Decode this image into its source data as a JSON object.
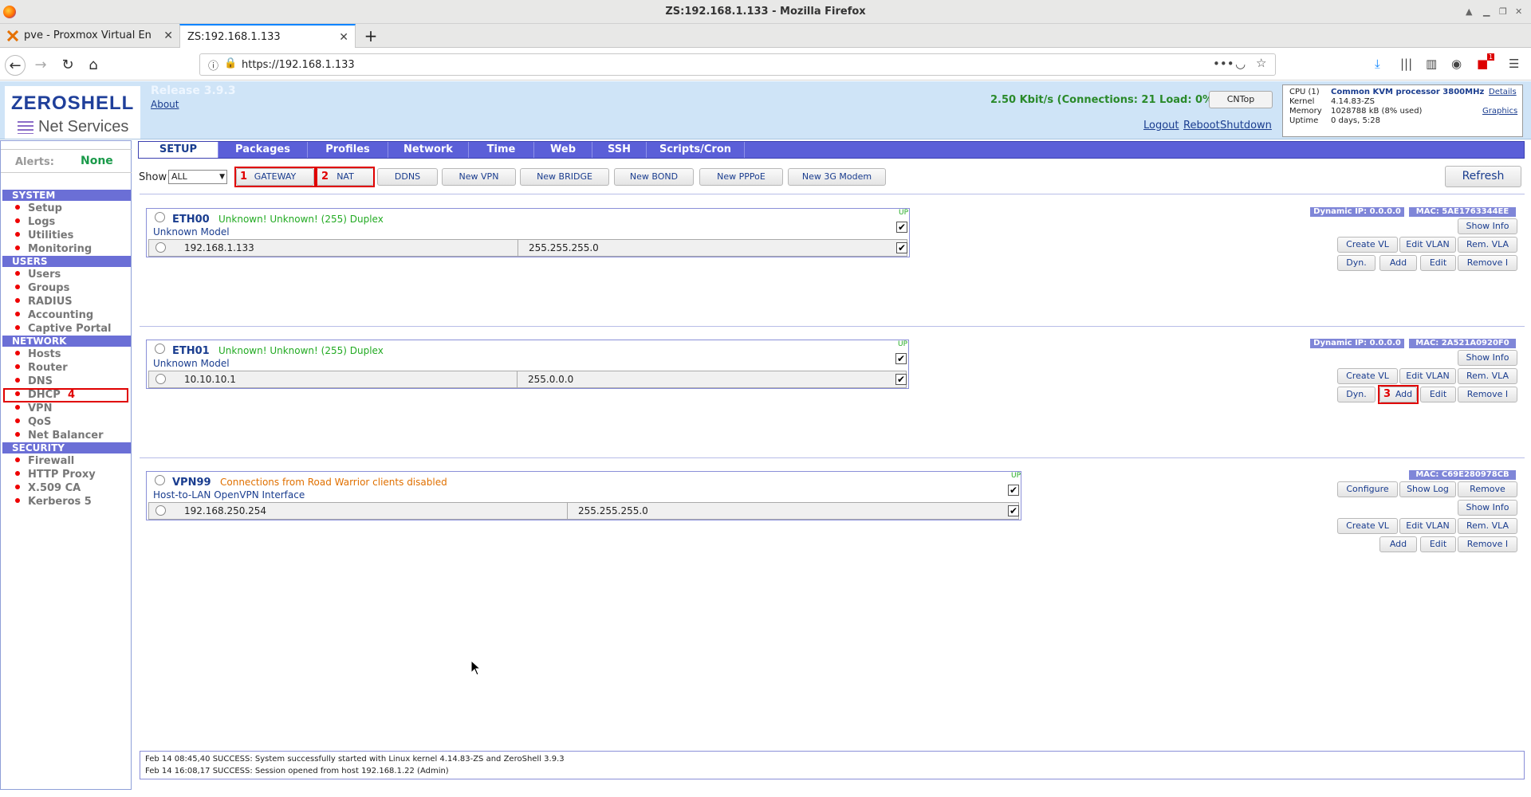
{
  "window": {
    "title": "ZS:192.168.1.133 - Mozilla Firefox"
  },
  "tabs": [
    {
      "label": "pve - Proxmox Virtual En"
    },
    {
      "label": "ZS:192.168.1.133"
    }
  ],
  "nav": {
    "url": "https://192.168.1.133",
    "badge": "1"
  },
  "header": {
    "logo_title": "ZEROSHELL",
    "logo_subtitle": "Net Services",
    "release": "Release 3.9.3",
    "about": "About",
    "traffic": "2.50 Kbit/s (Connections: 21 Load: 0%)",
    "cntop": "CNTop",
    "logout": "Logout",
    "reboot": "Reboot",
    "shutdown": "Shutdown",
    "sysinfo": {
      "cpu_label": "CPU (1)",
      "cpu_value": "Common KVM processor 3800MHz",
      "details": "Details",
      "kernel_label": "Kernel",
      "kernel_value": "4.14.83-ZS",
      "memory_label": "Memory",
      "memory_value": "1028788 kB  (8% used)",
      "graphics": "Graphics",
      "uptime_label": "Uptime",
      "uptime_value": "0 days, 5:28"
    }
  },
  "sidebar": {
    "alerts_label": "Alerts:",
    "alerts_value": "None",
    "sections": [
      {
        "title": "SYSTEM",
        "items": [
          "Setup",
          "Logs",
          "Utilities",
          "Monitoring"
        ]
      },
      {
        "title": "USERS",
        "items": [
          "Users",
          "Groups",
          "RADIUS",
          "Accounting",
          "Captive Portal"
        ]
      },
      {
        "title": "NETWORK",
        "items": [
          "Hosts",
          "Router",
          "DNS",
          "DHCP",
          "VPN",
          "QoS",
          "Net Balancer"
        ]
      },
      {
        "title": "SECURITY",
        "items": [
          "Firewall",
          "HTTP Proxy",
          "X.509 CA",
          "Kerberos 5"
        ]
      }
    ]
  },
  "menu": [
    "SETUP",
    "Packages",
    "Profiles",
    "Network",
    "Time",
    "Web",
    "SSH",
    "Scripts/Cron"
  ],
  "toolbar": {
    "show_label": "Show",
    "show_value": "ALL",
    "buttons": [
      "GATEWAY",
      "NAT",
      "DDNS",
      "New VPN",
      "New BRIDGE",
      "New BOND",
      "New PPPoE",
      "New 3G Modem"
    ],
    "refresh": "Refresh"
  },
  "annotations": [
    "1",
    "2",
    "3",
    "4"
  ],
  "interfaces": [
    {
      "name": "ETH00",
      "status": "Unknown! Unknown! (255) Duplex",
      "model": "Unknown Model",
      "up": "UP",
      "ip": "192.168.1.133",
      "mask": "255.255.255.0",
      "dynip": "Dynamic IP: 0.0.0.0",
      "mac": "MAC: 5AE1763344EE"
    },
    {
      "name": "ETH01",
      "status": "Unknown! Unknown! (255) Duplex",
      "model": "Unknown Model",
      "up": "UP",
      "ip": "10.10.10.1",
      "mask": "255.0.0.0",
      "dynip": "Dynamic IP: 0.0.0.0",
      "mac": "MAC: 2A521A0920F0"
    },
    {
      "name": "VPN99",
      "status": "Connections from Road Warrior clients disabled",
      "model": "Host-to-LAN OpenVPN Interface",
      "up": "UP",
      "ip": "192.168.250.254",
      "mask": "255.255.255.0",
      "mac": "MAC: C69E280978CB"
    }
  ],
  "iface_buttons": {
    "show_info": "Show Info",
    "create_vlan": "Create VL",
    "edit_vlan": "Edit VLAN",
    "rem_vlan": "Rem. VLA",
    "dyn": "Dyn.",
    "add": "Add",
    "edit": "Edit",
    "remove_ip": "Remove I",
    "configure": "Configure",
    "show_log": "Show Log",
    "remove": "Remove"
  },
  "log": [
    "Feb 14 08:45,40 SUCCESS: System successfully started with Linux kernel 4.14.83-ZS and ZeroShell 3.9.3",
    "Feb 14 16:08,17 SUCCESS: Session opened from host 192.168.1.22 (Admin)"
  ],
  "colors": {
    "menu": "#5b5fd8",
    "header": "#cfe4f7",
    "annotation": "#e00000",
    "status_green": "#22aa22",
    "status_orange": "#e07000"
  }
}
